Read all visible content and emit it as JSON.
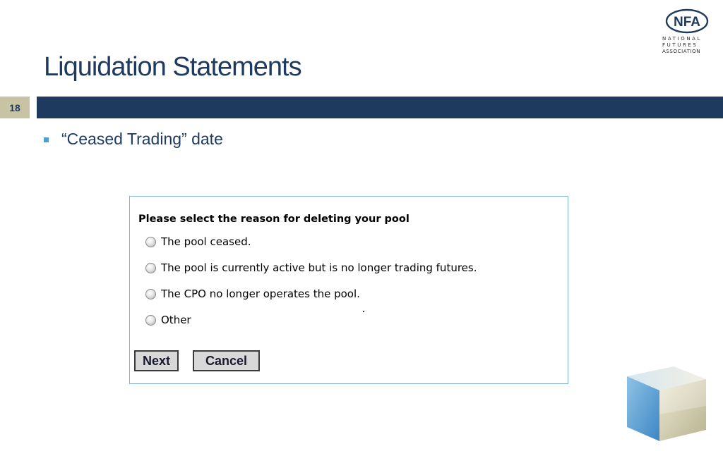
{
  "logo": {
    "mark": "NFA",
    "lines": [
      "NATIONAL",
      "FUTURES",
      "ASSOCIATION"
    ]
  },
  "slide": {
    "title": "Liquidation Statements",
    "number": "18"
  },
  "bullet": {
    "text": "“Ceased Trading” date"
  },
  "form": {
    "question": "Please select the reason for deleting your pool",
    "options": [
      "The pool ceased.",
      "The pool is currently active but is no longer trading futures.",
      "The CPO no longer operates the pool.",
      "Other"
    ],
    "next_label": "Next",
    "cancel_label": "Cancel"
  },
  "colors": {
    "navy": "#1f3a5f",
    "tan": "#c9c3a6",
    "bullet_blue": "#4a9fd4",
    "form_border": "#7eb3d6"
  }
}
